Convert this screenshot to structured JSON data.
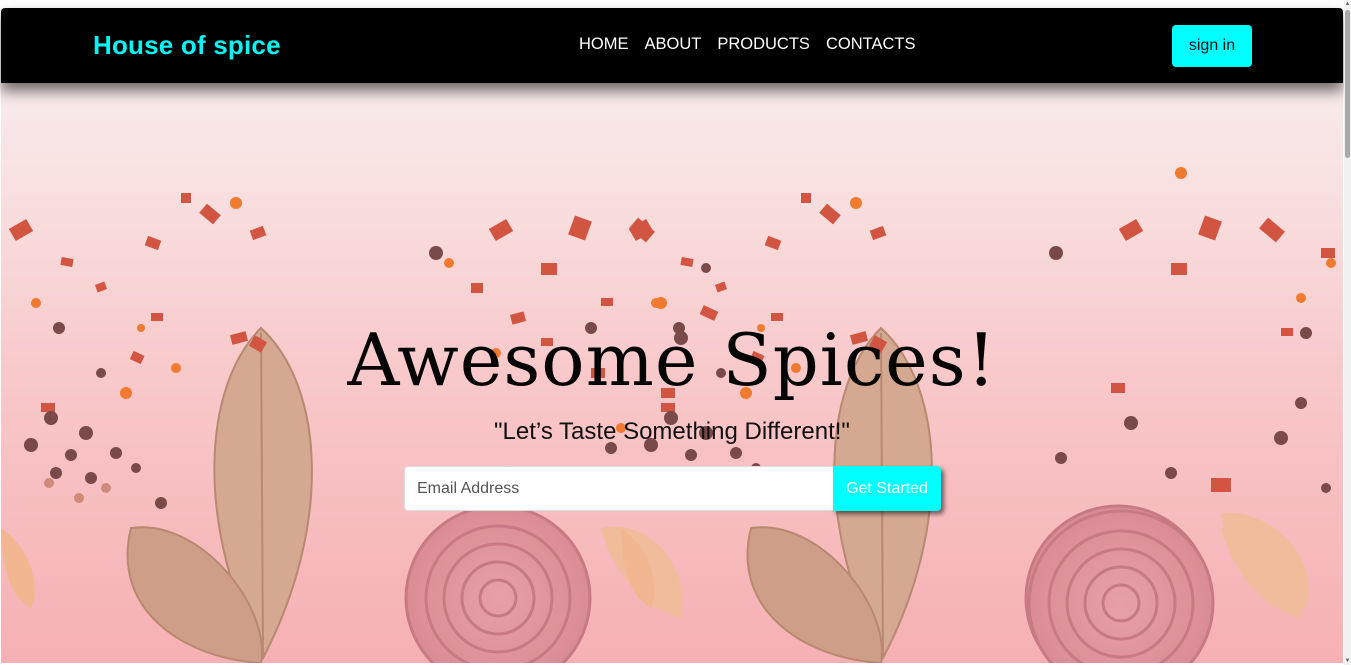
{
  "navbar": {
    "brand": "House of spice",
    "links": [
      "HOME",
      "ABOUT",
      "PRODUCTS",
      "CONTACTS"
    ],
    "signin_label": "sign in"
  },
  "hero": {
    "title": "Awesome Spices!",
    "subtitle": "\"Let’s Taste Something Different!\"",
    "email_placeholder": "Email Address",
    "cta_label": "Get Started"
  },
  "colors": {
    "accent": "#00ffff",
    "navbar_bg": "#000000",
    "brand": "#00f6f6"
  }
}
